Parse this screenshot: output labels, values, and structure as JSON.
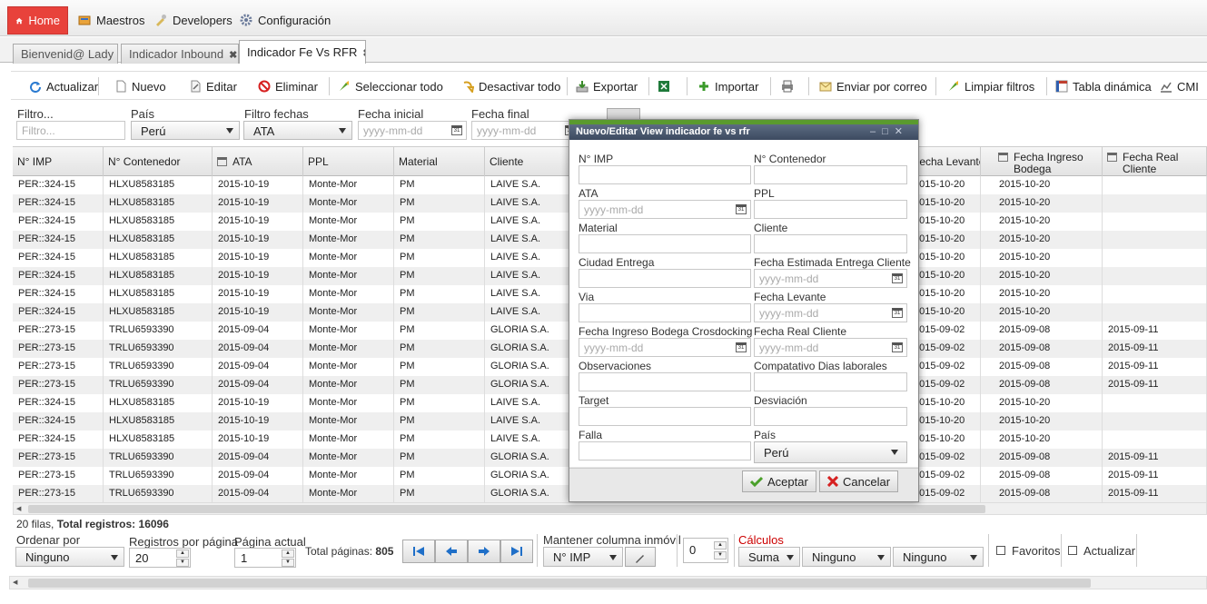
{
  "menu": {
    "home": "Home",
    "maestros": "Maestros",
    "developers": "Developers",
    "configuracion": "Configuración"
  },
  "tabs": [
    {
      "label": "Bienvenid@ Lady G"
    },
    {
      "label": "Indicador Inbound"
    },
    {
      "label": "Indicador Fe Vs RFR"
    }
  ],
  "toolbar": {
    "actualizar": "Actualizar",
    "nuevo": "Nuevo",
    "editar": "Editar",
    "eliminar": "Eliminar",
    "seleccionar_todo": "Seleccionar todo",
    "desactivar_todo": "Desactivar todo",
    "exportar": "Exportar",
    "importar": "Importar",
    "enviar_correo": "Enviar por correo",
    "limpiar_filtros": "Limpiar filtros",
    "tabla_dinamica": "Tabla dinámica",
    "cmi": "CMI"
  },
  "filters": {
    "filtro_label": "Filtro...",
    "filtro_placeholder": "Filtro...",
    "pais_label": "País",
    "pais_value": "Perú",
    "fechas_label": "Filtro fechas",
    "fechas_value": "ATA",
    "inicial_label": "Fecha inicial",
    "inicial_placeholder": "yyyy-mm-dd",
    "final_label": "Fecha final",
    "final_placeholder": "yyyy-mm-dd"
  },
  "grid": {
    "headers": [
      "N° IMP",
      "N° Contenedor",
      "ATA",
      "PPL",
      "Material",
      "Cliente",
      "Fecha Levante",
      "Fecha Ingreso Bodega",
      "Fecha Real Cliente"
    ],
    "rows": [
      [
        "PER::324-15",
        "HLXU8583185",
        "2015-10-19",
        "Monte-Mor",
        "PM",
        "LAIVE S.A.",
        "2015-10-20",
        "2015-10-20",
        ""
      ],
      [
        "PER::324-15",
        "HLXU8583185",
        "2015-10-19",
        "Monte-Mor",
        "PM",
        "LAIVE S.A.",
        "2015-10-20",
        "2015-10-20",
        ""
      ],
      [
        "PER::324-15",
        "HLXU8583185",
        "2015-10-19",
        "Monte-Mor",
        "PM",
        "LAIVE S.A.",
        "2015-10-20",
        "2015-10-20",
        ""
      ],
      [
        "PER::324-15",
        "HLXU8583185",
        "2015-10-19",
        "Monte-Mor",
        "PM",
        "LAIVE S.A.",
        "2015-10-20",
        "2015-10-20",
        ""
      ],
      [
        "PER::324-15",
        "HLXU8583185",
        "2015-10-19",
        "Monte-Mor",
        "PM",
        "LAIVE S.A.",
        "2015-10-20",
        "2015-10-20",
        ""
      ],
      [
        "PER::324-15",
        "HLXU8583185",
        "2015-10-19",
        "Monte-Mor",
        "PM",
        "LAIVE S.A.",
        "2015-10-20",
        "2015-10-20",
        ""
      ],
      [
        "PER::324-15",
        "HLXU8583185",
        "2015-10-19",
        "Monte-Mor",
        "PM",
        "LAIVE S.A.",
        "2015-10-20",
        "2015-10-20",
        ""
      ],
      [
        "PER::324-15",
        "HLXU8583185",
        "2015-10-19",
        "Monte-Mor",
        "PM",
        "LAIVE S.A.",
        "2015-10-20",
        "2015-10-20",
        ""
      ],
      [
        "PER::273-15",
        "TRLU6593390",
        "2015-09-04",
        "Monte-Mor",
        "PM",
        "GLORIA S.A.",
        "2015-09-02",
        "2015-09-08",
        "2015-09-11"
      ],
      [
        "PER::273-15",
        "TRLU6593390",
        "2015-09-04",
        "Monte-Mor",
        "PM",
        "GLORIA S.A.",
        "2015-09-02",
        "2015-09-08",
        "2015-09-11"
      ],
      [
        "PER::273-15",
        "TRLU6593390",
        "2015-09-04",
        "Monte-Mor",
        "PM",
        "GLORIA S.A.",
        "2015-09-02",
        "2015-09-08",
        "2015-09-11"
      ],
      [
        "PER::273-15",
        "TRLU6593390",
        "2015-09-04",
        "Monte-Mor",
        "PM",
        "GLORIA S.A.",
        "2015-09-02",
        "2015-09-08",
        "2015-09-11"
      ],
      [
        "PER::324-15",
        "HLXU8583185",
        "2015-10-19",
        "Monte-Mor",
        "PM",
        "LAIVE S.A.",
        "2015-10-20",
        "2015-10-20",
        ""
      ],
      [
        "PER::324-15",
        "HLXU8583185",
        "2015-10-19",
        "Monte-Mor",
        "PM",
        "LAIVE S.A.",
        "2015-10-20",
        "2015-10-20",
        ""
      ],
      [
        "PER::324-15",
        "HLXU8583185",
        "2015-10-19",
        "Monte-Mor",
        "PM",
        "LAIVE S.A.",
        "2015-10-20",
        "2015-10-20",
        ""
      ],
      [
        "PER::273-15",
        "TRLU6593390",
        "2015-09-04",
        "Monte-Mor",
        "PM",
        "GLORIA S.A.",
        "2015-09-02",
        "2015-09-08",
        "2015-09-11"
      ],
      [
        "PER::273-15",
        "TRLU6593390",
        "2015-09-04",
        "Monte-Mor",
        "PM",
        "GLORIA S.A.",
        "2015-09-02",
        "2015-09-08",
        "2015-09-11"
      ],
      [
        "PER::273-15",
        "TRLU6593390",
        "2015-09-04",
        "Monte-Mor",
        "PM",
        "GLORIA S.A.",
        "2015-09-02",
        "2015-09-08",
        "2015-09-11"
      ]
    ]
  },
  "status": {
    "filas": "20 filas,",
    "total_label": "Total registros:",
    "total_value": "16096"
  },
  "pager": {
    "ordenar_label": "Ordenar por",
    "ordenar_value": "Ninguno",
    "registros_label": "Registros por página",
    "registros_value": "20",
    "pagina_label": "Página actual",
    "pagina_value": "1",
    "total_paginas_label": "Total páginas:",
    "total_paginas_value": "805",
    "mantener_label": "Mantener columna inmóvil",
    "mantener_value": "N° IMP",
    "spin_value": "0",
    "calculos_label": "Cálculos",
    "calc_1": "Suma",
    "calc_2": "Ninguno",
    "calc_3": "Ninguno",
    "favoritos": "Favoritos",
    "actualizar": "Actualizar"
  },
  "dialog": {
    "title": "Nuevo/Editar View indicador fe vs rfr",
    "date_placeholder": "yyyy-mm-dd",
    "fields": {
      "nimp": "N° IMP",
      "contenedor": "N° Contenedor",
      "ata": "ATA",
      "ppl": "PPL",
      "material": "Material",
      "cliente": "Cliente",
      "ciudad": "Ciudad Entrega",
      "fecha_estimada": "Fecha Estimada Entrega Cliente",
      "via": "Via",
      "fecha_levante": "Fecha Levante",
      "fecha_ingreso": "Fecha Ingreso Bodega Crosdocking",
      "fecha_real": "Fecha Real Cliente",
      "observaciones": "Observaciones",
      "compatativo": "Compatativo Dias laborales",
      "target": "Target",
      "desviacion": "Desviación",
      "falla": "Falla",
      "pais": "País"
    },
    "pais_value": "Perú",
    "aceptar": "Aceptar",
    "cancelar": "Cancelar"
  },
  "colors": {
    "home_bg": "#e8423b",
    "dialog_title_bg": "#4a586e",
    "dialog_accent": "#5a9a2e",
    "calculos_label": "#cc0000",
    "pager_arrow": "#1f6fc8"
  }
}
